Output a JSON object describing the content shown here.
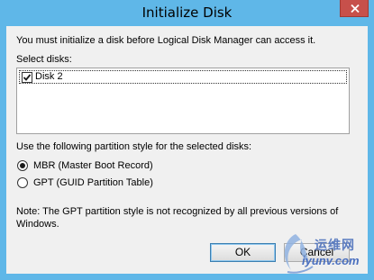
{
  "window": {
    "title": "Initialize Disk"
  },
  "dialog": {
    "intro": "You must initialize a disk before Logical Disk Manager can access it.",
    "select_disks_label": "Select disks:",
    "disks": [
      {
        "label": "Disk 2",
        "checked": true
      }
    ],
    "partition_style_label": "Use the following partition style for the selected disks:",
    "partition_options": [
      {
        "label": "MBR (Master Boot Record)",
        "selected": true
      },
      {
        "label": "GPT (GUID Partition Table)",
        "selected": false
      }
    ],
    "note": "Note: The GPT partition style is not recognized by all previous versions of Windows.",
    "ok_label": "OK",
    "cancel_label": "Cancel"
  },
  "watermark": {
    "chinese": "运维网",
    "url": "iyunv.com"
  },
  "colors": {
    "title_bar": "#5fb7e8",
    "close_button": "#c7504b",
    "client_bg": "#f0f0f0"
  }
}
